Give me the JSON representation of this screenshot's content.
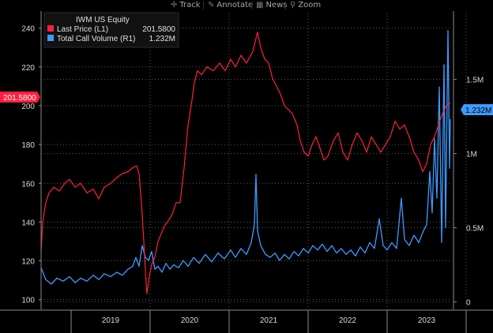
{
  "toolbar": {
    "items": [
      {
        "label": "Track",
        "icon": "crosshair-icon",
        "glyph": "✛"
      },
      {
        "label": "Annotate",
        "icon": "pencil-icon",
        "glyph": "✎"
      },
      {
        "label": "News",
        "icon": "news-icon",
        "glyph": "▦"
      },
      {
        "label": "Zoom",
        "icon": "magnifier-icon",
        "glyph": "⚲"
      }
    ]
  },
  "legend": {
    "title": "IWM US Equity",
    "entries": [
      {
        "label": "Last Price  (L1)",
        "value": "201.5800",
        "color": "#ff1f3d"
      },
      {
        "label": "Total Call Volume  (R1)",
        "value": "1.232M",
        "color": "#3d9bff"
      }
    ]
  },
  "last_value_flags": {
    "left": "201.5800",
    "right": "1.232M"
  },
  "chart_data": {
    "type": "line",
    "x_unit": "year",
    "x_range": [
      2018.62,
      2023.82
    ],
    "x_tick_labels": [
      "2019",
      "2020",
      "2021",
      "2022",
      "2023"
    ],
    "left_axis": {
      "ticks": [
        100,
        120,
        140,
        160,
        180,
        200,
        220,
        240
      ],
      "ylim": [
        95,
        248
      ]
    },
    "right_axis": {
      "ticks": [
        0,
        500000,
        1000000,
        1500000
      ],
      "tick_labels": [
        "0",
        "0.5M",
        "1M",
        "1.5M"
      ],
      "ylim": [
        -50000,
        1950000
      ]
    },
    "grid": true,
    "colors": {
      "price": "#ff1f3d",
      "volume": "#3d9bff",
      "grid": "#5a5a5a",
      "axis": "#8a8a8a"
    },
    "series": [
      {
        "name": "Last Price",
        "axis": "left",
        "points": [
          [
            2018.62,
            125
          ],
          [
            2018.64,
            140
          ],
          [
            2018.68,
            150
          ],
          [
            2018.72,
            155
          ],
          [
            2018.78,
            158
          ],
          [
            2018.85,
            156
          ],
          [
            2018.92,
            160
          ],
          [
            2018.98,
            162
          ],
          [
            2019.05,
            158
          ],
          [
            2019.12,
            160
          ],
          [
            2019.2,
            155
          ],
          [
            2019.28,
            157
          ],
          [
            2019.35,
            152
          ],
          [
            2019.42,
            158
          ],
          [
            2019.5,
            160
          ],
          [
            2019.58,
            163
          ],
          [
            2019.65,
            165
          ],
          [
            2019.72,
            166
          ],
          [
            2019.78,
            168
          ],
          [
            2019.83,
            169
          ],
          [
            2019.86,
            165
          ],
          [
            2019.89,
            150
          ],
          [
            2019.92,
            130
          ],
          [
            2019.94,
            115
          ],
          [
            2019.96,
            103
          ],
          [
            2019.99,
            112
          ],
          [
            2020.02,
            118
          ],
          [
            2020.06,
            122
          ],
          [
            2020.1,
            130
          ],
          [
            2020.14,
            134
          ],
          [
            2020.18,
            138
          ],
          [
            2020.22,
            140
          ],
          [
            2020.28,
            144
          ],
          [
            2020.33,
            150
          ],
          [
            2020.38,
            150
          ],
          [
            2020.43,
            168
          ],
          [
            2020.48,
            190
          ],
          [
            2020.52,
            200
          ],
          [
            2020.56,
            212
          ],
          [
            2020.6,
            218
          ],
          [
            2020.65,
            216
          ],
          [
            2020.72,
            220
          ],
          [
            2020.8,
            218
          ],
          [
            2020.88,
            222
          ],
          [
            2020.95,
            218
          ],
          [
            2021.02,
            224
          ],
          [
            2021.08,
            220
          ],
          [
            2021.15,
            226
          ],
          [
            2021.22,
            222
          ],
          [
            2021.3,
            228
          ],
          [
            2021.36,
            238
          ],
          [
            2021.4,
            230
          ],
          [
            2021.45,
            224
          ],
          [
            2021.5,
            222
          ],
          [
            2021.55,
            214
          ],
          [
            2021.6,
            210
          ],
          [
            2021.65,
            206
          ],
          [
            2021.7,
            200
          ],
          [
            2021.75,
            198
          ],
          [
            2021.8,
            196
          ],
          [
            2021.86,
            190
          ],
          [
            2021.9,
            182
          ],
          [
            2021.95,
            176
          ],
          [
            2022.0,
            174
          ],
          [
            2022.05,
            180
          ],
          [
            2022.1,
            184
          ],
          [
            2022.15,
            178
          ],
          [
            2022.2,
            172
          ],
          [
            2022.25,
            174
          ],
          [
            2022.32,
            182
          ],
          [
            2022.38,
            186
          ],
          [
            2022.44,
            176
          ],
          [
            2022.5,
            172
          ],
          [
            2022.56,
            180
          ],
          [
            2022.62,
            186
          ],
          [
            2022.68,
            182
          ],
          [
            2022.74,
            176
          ],
          [
            2022.8,
            184
          ],
          [
            2022.86,
            180
          ],
          [
            2022.92,
            176
          ],
          [
            2022.98,
            180
          ],
          [
            2023.04,
            184
          ],
          [
            2023.1,
            192
          ],
          [
            2023.16,
            188
          ],
          [
            2023.22,
            190
          ],
          [
            2023.28,
            184
          ],
          [
            2023.34,
            176
          ],
          [
            2023.4,
            172
          ],
          [
            2023.45,
            166
          ],
          [
            2023.5,
            170
          ],
          [
            2023.55,
            180
          ],
          [
            2023.6,
            184
          ],
          [
            2023.65,
            190
          ],
          [
            2023.7,
            196
          ],
          [
            2023.75,
            200
          ],
          [
            2023.8,
            201.58
          ]
        ]
      },
      {
        "name": "Total Call Volume",
        "axis": "right",
        "points": [
          [
            2018.62,
            230000
          ],
          [
            2018.68,
            150000
          ],
          [
            2018.75,
            120000
          ],
          [
            2018.82,
            160000
          ],
          [
            2018.9,
            140000
          ],
          [
            2018.98,
            170000
          ],
          [
            2019.05,
            130000
          ],
          [
            2019.12,
            160000
          ],
          [
            2019.2,
            140000
          ],
          [
            2019.28,
            180000
          ],
          [
            2019.35,
            150000
          ],
          [
            2019.42,
            190000
          ],
          [
            2019.5,
            170000
          ],
          [
            2019.58,
            200000
          ],
          [
            2019.65,
            180000
          ],
          [
            2019.72,
            220000
          ],
          [
            2019.78,
            240000
          ],
          [
            2019.82,
            300000
          ],
          [
            2019.86,
            240000
          ],
          [
            2019.9,
            380000
          ],
          [
            2019.94,
            300000
          ],
          [
            2019.98,
            280000
          ],
          [
            2020.02,
            340000
          ],
          [
            2020.06,
            220000
          ],
          [
            2020.1,
            240000
          ],
          [
            2020.15,
            200000
          ],
          [
            2020.2,
            260000
          ],
          [
            2020.25,
            220000
          ],
          [
            2020.3,
            250000
          ],
          [
            2020.36,
            230000
          ],
          [
            2020.42,
            280000
          ],
          [
            2020.48,
            240000
          ],
          [
            2020.55,
            300000
          ],
          [
            2020.62,
            260000
          ],
          [
            2020.7,
            320000
          ],
          [
            2020.78,
            270000
          ],
          [
            2020.86,
            330000
          ],
          [
            2020.94,
            290000
          ],
          [
            2021.02,
            350000
          ],
          [
            2021.08,
            300000
          ],
          [
            2021.15,
            360000
          ],
          [
            2021.22,
            320000
          ],
          [
            2021.28,
            400000
          ],
          [
            2021.32,
            520000
          ],
          [
            2021.34,
            860000
          ],
          [
            2021.36,
            480000
          ],
          [
            2021.4,
            380000
          ],
          [
            2021.46,
            320000
          ],
          [
            2021.52,
            300000
          ],
          [
            2021.58,
            330000
          ],
          [
            2021.64,
            280000
          ],
          [
            2021.7,
            320000
          ],
          [
            2021.76,
            290000
          ],
          [
            2021.82,
            340000
          ],
          [
            2021.88,
            310000
          ],
          [
            2021.94,
            360000
          ],
          [
            2022.0,
            330000
          ],
          [
            2022.06,
            380000
          ],
          [
            2022.12,
            350000
          ],
          [
            2022.18,
            390000
          ],
          [
            2022.24,
            340000
          ],
          [
            2022.3,
            380000
          ],
          [
            2022.36,
            330000
          ],
          [
            2022.42,
            360000
          ],
          [
            2022.48,
            320000
          ],
          [
            2022.54,
            350000
          ],
          [
            2022.6,
            310000
          ],
          [
            2022.66,
            370000
          ],
          [
            2022.72,
            330000
          ],
          [
            2022.78,
            400000
          ],
          [
            2022.84,
            360000
          ],
          [
            2022.9,
            560000
          ],
          [
            2022.95,
            380000
          ],
          [
            2023.0,
            350000
          ],
          [
            2023.06,
            400000
          ],
          [
            2023.12,
            360000
          ],
          [
            2023.18,
            700000
          ],
          [
            2023.22,
            420000
          ],
          [
            2023.28,
            380000
          ],
          [
            2023.34,
            450000
          ],
          [
            2023.4,
            400000
          ],
          [
            2023.46,
            480000
          ],
          [
            2023.5,
            520000
          ],
          [
            2023.54,
            880000
          ],
          [
            2023.57,
            600000
          ],
          [
            2023.6,
            1100000
          ],
          [
            2023.63,
            700000
          ],
          [
            2023.66,
            1450000
          ],
          [
            2023.69,
            400000
          ],
          [
            2023.72,
            1600000
          ],
          [
            2023.74,
            500000
          ],
          [
            2023.77,
            1830000
          ],
          [
            2023.79,
            900000
          ],
          [
            2023.8,
            1232000
          ]
        ]
      }
    ]
  }
}
